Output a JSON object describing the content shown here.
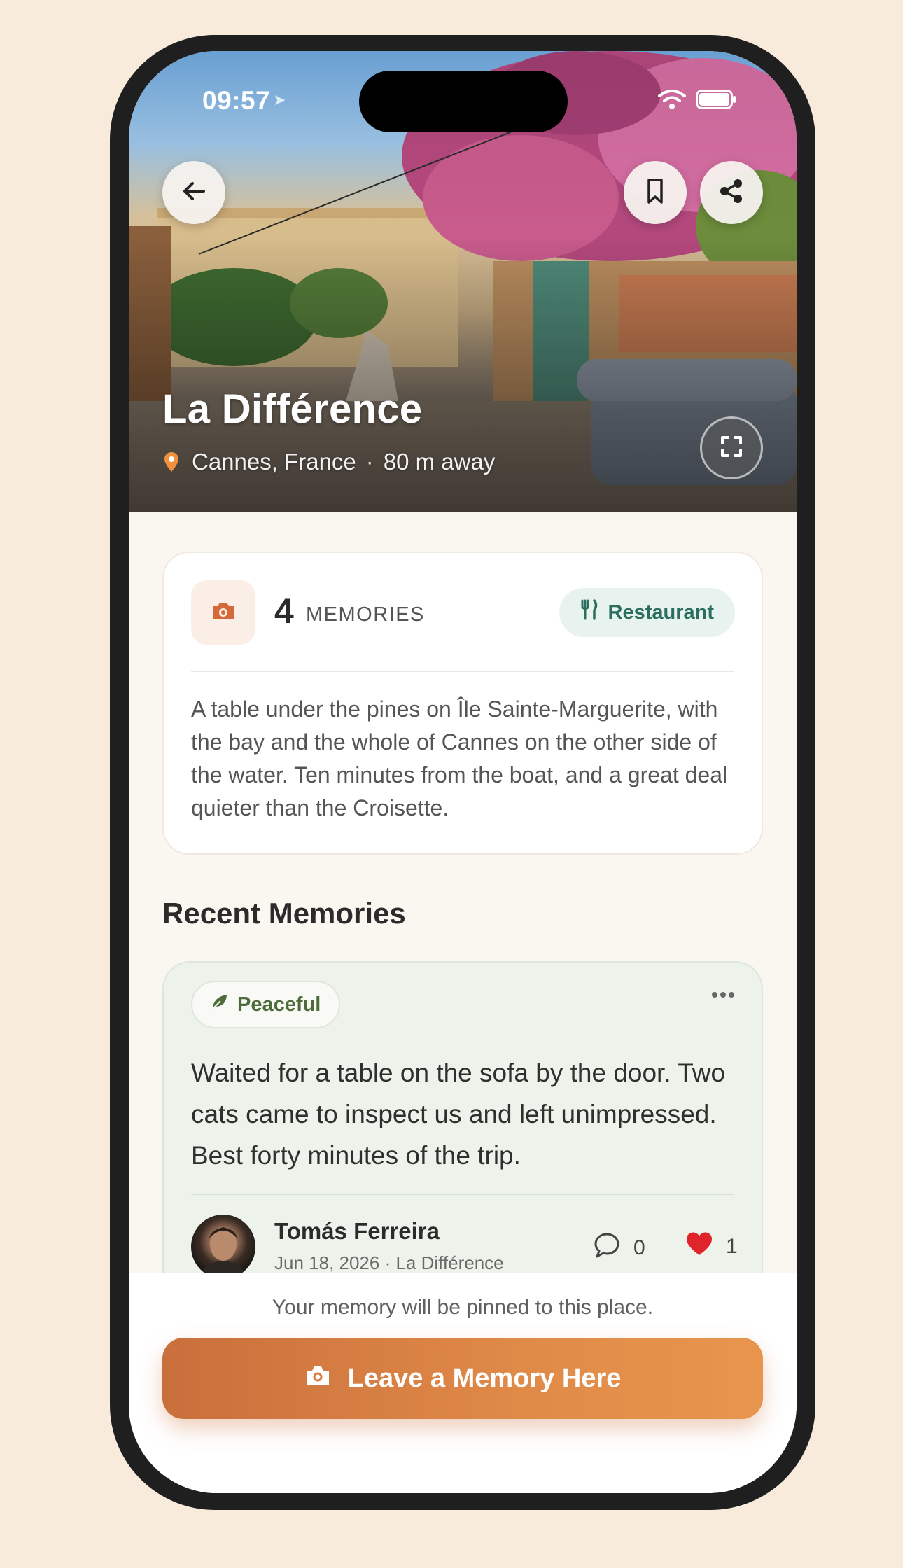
{
  "status_bar": {
    "time": "09:57"
  },
  "hero": {
    "title": "La Différence",
    "location": "Cannes, France",
    "separator": "·",
    "distance": "80 m away"
  },
  "info": {
    "memory_count": "4",
    "memory_label": "MEMORIES",
    "category": "Restaurant",
    "description": "A table under the pines on Île Sainte-Marguerite, with the bay and the whole of Cannes on the other side of the water. Ten minutes from the boat, and a great deal quieter than the Croisette."
  },
  "section_title": "Recent Memories",
  "memory": {
    "mood": "Peaceful",
    "text": "Waited for a table on the sofa by the door. Two cats came to inspect us and left unimpressed. Best forty minutes of the trip.",
    "author": "Tomás Ferreira",
    "meta": "Jun 18, 2026 · La Différence",
    "comments": "0",
    "likes": "1"
  },
  "bottom": {
    "note": "Your memory will be pinned to this place.",
    "cta_label": "Leave a Memory Here"
  },
  "colors": {
    "accent": "#e08a48",
    "category_text": "#2a6e5e",
    "mood_text": "#4e6b3a",
    "like": "#e0242b"
  },
  "icons": [
    "back-arrow-icon",
    "bookmark-icon",
    "share-icon",
    "expand-icon",
    "location-pin-icon",
    "camera-icon",
    "utensils-icon",
    "leaf-icon",
    "more-icon",
    "comment-icon",
    "heart-icon",
    "wifi-icon",
    "battery-icon"
  ]
}
